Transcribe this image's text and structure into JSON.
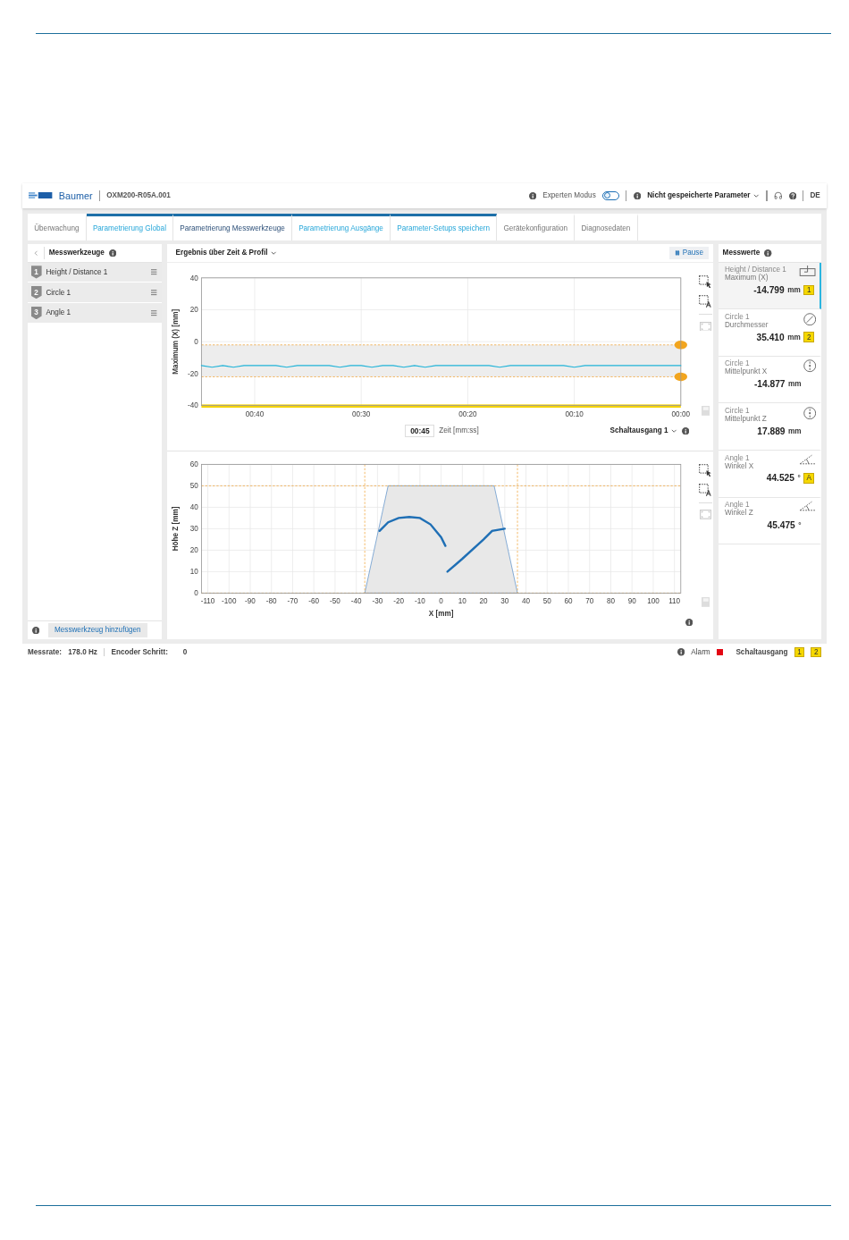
{
  "header": {
    "logo": "Baumer",
    "device": "OXM200-R05A.001",
    "expert_mode": {
      "label": "Experten Modus",
      "on": false
    },
    "unsaved": "Nicht gespeicherte Parameter",
    "language": "DE"
  },
  "tabs": [
    {
      "label": "Überwachung",
      "selected": false,
      "grouped": false
    },
    {
      "label": "Parametrierung Global",
      "selected": false,
      "grouped": true
    },
    {
      "label": "Parametrierung Messwerkzeuge",
      "selected": true,
      "grouped": true
    },
    {
      "label": "Parametrierung Ausgänge",
      "selected": false,
      "grouped": true
    },
    {
      "label": "Parameter-Setups speichern",
      "selected": false,
      "grouped": true
    },
    {
      "label": "Gerätekonfiguration",
      "selected": false,
      "grouped": false
    },
    {
      "label": "Diagnosedaten",
      "selected": false,
      "grouped": false
    }
  ],
  "tools_panel": {
    "title": "Messwerkzeuge",
    "tools": [
      {
        "number": "1",
        "name": "Height / Distance 1"
      },
      {
        "number": "2",
        "name": "Circle 1"
      },
      {
        "number": "3",
        "name": "Angle 1"
      }
    ],
    "add_button": "Messwerkzeug hinzufügen"
  },
  "chart_panel": {
    "title": "Ergebnis über Zeit & Profil",
    "pause": "Pause",
    "time_value": "00:45",
    "output_select": "Schaltausgang 1",
    "time_chart": {
      "chart_data": {
        "type": "line",
        "grid": true,
        "ref_lines": [
          {
            "axis": "y",
            "value": -2,
            "color": "#f0a030"
          },
          {
            "axis": "y",
            "value": -22,
            "color": "#f0a030"
          }
        ],
        "xlabel": "Zeit [mm:ss]",
        "ylabel": "Maximum (X) [mm]",
        "xlim": [
          45,
          0
        ],
        "ylim": [
          -40,
          40
        ],
        "xticks": [
          {
            "value": 40,
            "label": "00:40"
          },
          {
            "value": 30,
            "label": "00:30"
          },
          {
            "value": 20,
            "label": "00:20"
          },
          {
            "value": 10,
            "label": "00:10"
          },
          {
            "value": 0,
            "label": "00:00"
          }
        ],
        "yticks": [
          -40,
          -20,
          0,
          20,
          40
        ],
        "x": [
          45,
          44,
          43,
          42,
          41,
          40,
          39,
          38,
          37,
          36,
          35,
          34,
          33,
          32,
          31,
          30,
          29,
          28,
          27,
          26,
          25,
          24,
          23,
          22,
          21,
          20,
          19,
          18,
          17,
          16,
          15,
          14,
          13,
          12,
          11,
          10,
          9,
          8,
          7,
          6,
          5,
          4,
          3,
          2,
          1,
          0
        ],
        "series": [
          {
            "color": "#1fb3d8",
            "values": [
              -15,
              -16,
              -15,
              -16,
              -15,
              -15,
              -15,
              -15,
              -16,
              -15,
              -15,
              -15,
              -15,
              -16,
              -15,
              -15,
              -16,
              -15,
              -15,
              -16,
              -15,
              -16,
              -15,
              -15,
              -15,
              -15,
              -15,
              -15,
              -16,
              -15,
              -15,
              -15,
              -15,
              -15,
              -15,
              -16,
              -15,
              -15,
              -15,
              -15,
              -15,
              -15,
              -15,
              -15,
              -15,
              -15
            ]
          }
        ]
      }
    },
    "profile_chart": {
      "chart_data": {
        "type": "line",
        "grid": true,
        "ref_lines": [
          {
            "axis": "x",
            "value": -36,
            "color": "#f0a030"
          },
          {
            "axis": "x",
            "value": 36,
            "color": "#f0a030"
          },
          {
            "axis": "y",
            "value": 50,
            "color": "#f0a030"
          },
          {
            "axis": "y",
            "value": 0,
            "color": "#f0a030"
          }
        ],
        "xlabel": "X [mm]",
        "ylabel": "Höhe Z [mm]",
        "xlim": [
          -113,
          113
        ],
        "ylim": [
          0,
          60
        ],
        "xticks": [
          -110,
          -100,
          -90,
          -80,
          -70,
          -60,
          -50,
          -40,
          -30,
          -20,
          -10,
          0,
          10,
          20,
          30,
          40,
          50,
          60,
          70,
          80,
          90,
          100,
          110
        ],
        "yticks": [
          0,
          10,
          20,
          30,
          40,
          50,
          60
        ],
        "x": [
          -29,
          -25,
          -20,
          -15,
          -10,
          -5,
          0,
          2,
          2.5,
          3,
          10,
          20,
          24,
          30
        ],
        "series": [
          {
            "color": "#1f6fb5",
            "values": [
              29,
              33,
              35,
              35.5,
              35,
              32,
              26,
              22,
              null,
              10,
              16,
              25,
              29,
              30
            ]
          }
        ]
      }
    }
  },
  "values_panel": {
    "title": "Messwerte",
    "items": [
      {
        "kind": "height",
        "tool": "Height / Distance 1",
        "measure": "Maximum (X)",
        "value": "-14.799",
        "unit": "mm",
        "badge": "1",
        "selected": true
      },
      {
        "kind": "diameter",
        "tool": "Circle 1",
        "measure": "Durchmesser",
        "value": "35.410",
        "unit": "mm",
        "badge": "2",
        "selected": false
      },
      {
        "kind": "center",
        "tool": "Circle 1",
        "measure": "Mittelpunkt X",
        "value": "-14.877",
        "unit": "mm",
        "selected": false
      },
      {
        "kind": "center",
        "tool": "Circle 1",
        "measure": "Mittelpunkt Z",
        "value": "17.889",
        "unit": "mm",
        "selected": false
      },
      {
        "kind": "angle",
        "tool": "Angle 1",
        "measure": "Winkel X",
        "value": "44.525",
        "unit": "°",
        "badge": "A",
        "selected": false
      },
      {
        "kind": "angle",
        "tool": "Angle 1",
        "measure": "Winkel Z",
        "value": "45.475",
        "unit": "°",
        "selected": false
      }
    ]
  },
  "status_bar": {
    "rate_label": "Messrate:",
    "rate": "178.0 Hz",
    "encoder_label": "Encoder Schritt:",
    "encoder": "0",
    "alarm": {
      "label": "Alarm",
      "active": true
    },
    "outputs_label": "Schaltausgang",
    "outputs": [
      "1",
      "2"
    ]
  }
}
